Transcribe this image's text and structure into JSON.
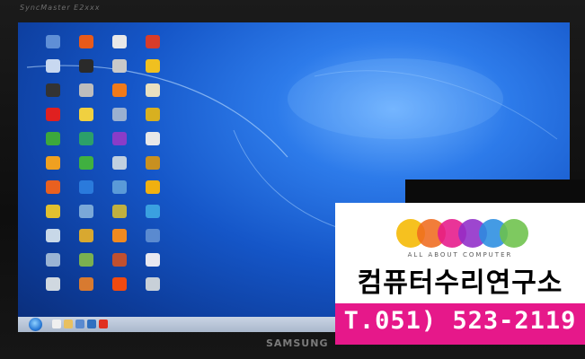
{
  "monitor": {
    "top_brand": "SyncMaster E2xxx",
    "bottom_brand": "SAMSUNG"
  },
  "desktop": {
    "icons": [
      {
        "color": "#5f8fd6"
      },
      {
        "color": "#e85a1a"
      },
      {
        "color": "#e8e8e8"
      },
      {
        "color": "#d83c2a"
      },
      {
        "color": "#c8d8f0"
      },
      {
        "color": "#2a2a2a"
      },
      {
        "color": "#c9c9c9"
      },
      {
        "color": "#f0c020"
      },
      {
        "color": "#333333"
      },
      {
        "color": "#bdbdbd"
      },
      {
        "color": "#f07a1a"
      },
      {
        "color": "#e8e0c0"
      },
      {
        "color": "#e02020"
      },
      {
        "color": "#f0d040"
      },
      {
        "color": "#9ab0d0"
      },
      {
        "color": "#d8b020"
      },
      {
        "color": "#3ca83c"
      },
      {
        "color": "#2ca06a"
      },
      {
        "color": "#8a3cc8"
      },
      {
        "color": "#e8e8e8"
      },
      {
        "color": "#f0a020"
      },
      {
        "color": "#40b040"
      },
      {
        "color": "#c0d0e0"
      },
      {
        "color": "#c89020"
      },
      {
        "color": "#e86020"
      },
      {
        "color": "#2a7adc"
      },
      {
        "color": "#5a9ad8"
      },
      {
        "color": "#f0b010"
      },
      {
        "color": "#e0c030"
      },
      {
        "color": "#7aa8d8"
      },
      {
        "color": "#c0b040"
      },
      {
        "color": "#3aa0e0"
      },
      {
        "color": "#c8d8e8"
      },
      {
        "color": "#d8a830"
      },
      {
        "color": "#f08a20"
      },
      {
        "color": "#5a8ad0"
      },
      {
        "color": "#9ab4d4"
      },
      {
        "color": "#7ab050"
      },
      {
        "color": "#c05030"
      },
      {
        "color": "#e8e8f0"
      },
      {
        "color": "#d0d8e0"
      },
      {
        "color": "#d87a30"
      },
      {
        "color": "#f04a10"
      },
      {
        "color": "#c8d0d8"
      }
    ]
  },
  "taskbar": {
    "items": [
      {
        "color": "#f0f0f0"
      },
      {
        "color": "#e8c060"
      },
      {
        "color": "#5a8ad0"
      },
      {
        "color": "#3070c0"
      },
      {
        "color": "#e03020"
      }
    ]
  },
  "ad": {
    "circle_colors": [
      "#f5b800",
      "#ef6b1f",
      "#e6188a",
      "#8f2cc8",
      "#2a8de0",
      "#6cc24a"
    ],
    "tagline": "ALL ABOUT COMPUTER",
    "headline": "컴퓨터수리연구소",
    "phone": "T.051) 523-2119"
  }
}
